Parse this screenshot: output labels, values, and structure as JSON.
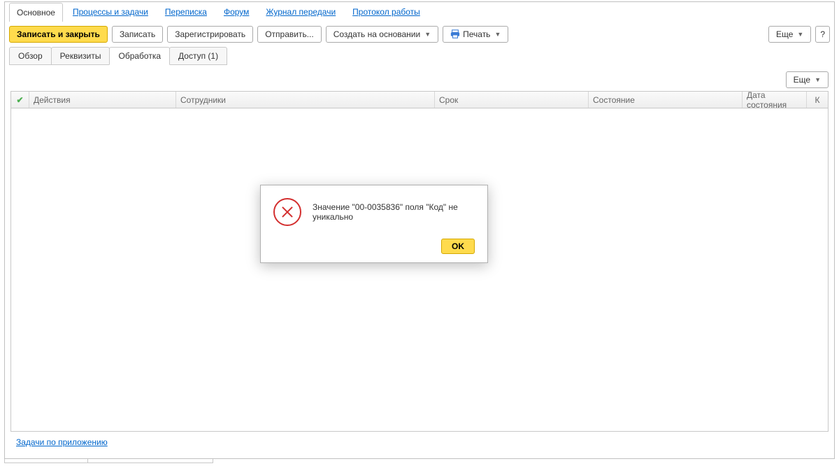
{
  "nav": {
    "main": "Основное",
    "processes": "Процессы и задачи",
    "correspondence": "Переписка",
    "forum": "Форум",
    "transfer_log": "Журнал передачи",
    "protocol": "Протокол работы"
  },
  "toolbar": {
    "save_close": "Записать и закрыть",
    "save": "Записать",
    "register": "Зарегистрировать",
    "send": "Отправить...",
    "create_based": "Создать на основании",
    "print": "Печать",
    "more": "Еще",
    "help": "?"
  },
  "subtabs": {
    "overview": "Обзор",
    "requisites": "Реквизиты",
    "processing": "Обработка",
    "access": "Доступ (1)"
  },
  "grid_more": "Еще",
  "columns": {
    "actions": "Действия",
    "employees": "Сотрудники",
    "deadline": "Срок",
    "state": "Состояние",
    "state_date": "Дата состояния",
    "k": "К"
  },
  "footer": {
    "tasks_link": "Задачи по приложению"
  },
  "modal": {
    "message": "Значение \"00-0035836\" поля \"Код\" не уникально",
    "ok": "OK"
  }
}
